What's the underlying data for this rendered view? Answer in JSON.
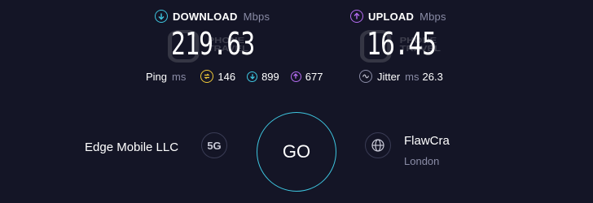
{
  "download": {
    "label": "DOWNLOAD",
    "unit": "Mbps",
    "value": "219.63",
    "icon": "download-arrow-icon",
    "color": "#3ec6e0"
  },
  "upload": {
    "label": "UPLOAD",
    "unit": "Mbps",
    "value": "16.45",
    "icon": "upload-arrow-icon",
    "color": "#b46cf0"
  },
  "watermark": {
    "line1": "PHONE",
    "line2": "TRAVEL"
  },
  "ping": {
    "label": "Ping",
    "unit": "ms",
    "idle": "146",
    "download": "899",
    "upload": "677",
    "idle_color": "#f0c93a"
  },
  "jitter": {
    "label": "Jitter",
    "unit": "ms",
    "value": "26.3"
  },
  "provider": {
    "name": "Edge Mobile LLC",
    "network": "5G"
  },
  "go_button": {
    "label": "GO",
    "color": "#3ec6e0"
  },
  "server": {
    "name": "FlawCra",
    "location": "London"
  }
}
